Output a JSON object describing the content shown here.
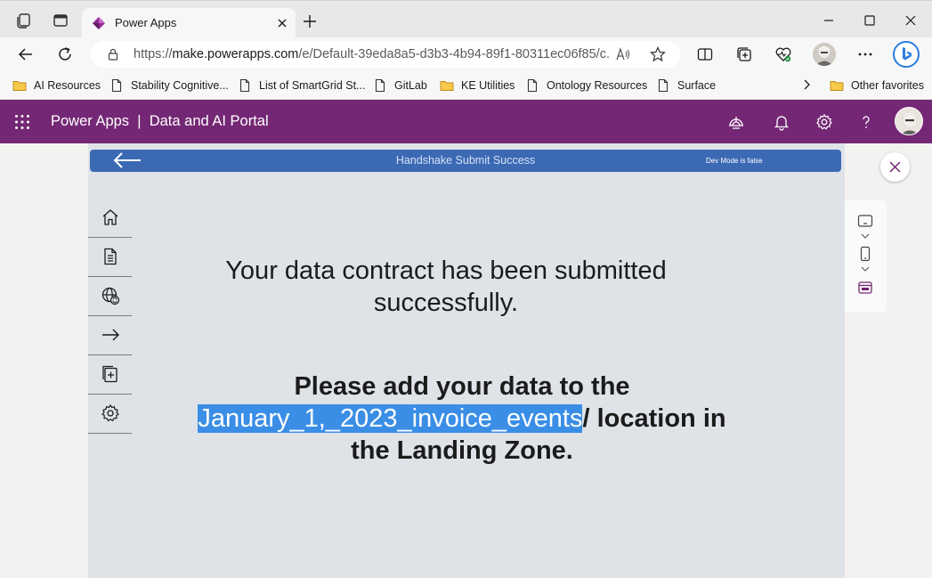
{
  "browser": {
    "tab_title": "Power Apps",
    "url_prefix": "https://",
    "url_host": "make.powerapps.com",
    "url_path": "/e/Default-39eda8a5-d3b3-4b94-89f1-80311ec06f85/c...",
    "favorites": [
      "AI Resources",
      "Stability Cognitive...",
      "List of SmartGrid St...",
      "GitLab",
      "KE Utilities",
      "Ontology Resources",
      "Surface"
    ],
    "other_favorites": "Other favorites"
  },
  "header": {
    "app_name": "Power Apps",
    "separator": "|",
    "environment": "Data and AI Portal"
  },
  "app": {
    "topbar_title": "Handshake Submit Success",
    "dev_mode": "Dev Mode is false",
    "message_1": "Your data contract has been submitted successfully.",
    "message_2_prefix": "Please add your data to the",
    "message_2_highlight": "January_1,_2023_invoice_events",
    "message_2_suffix": "/ location in the Landing Zone.",
    "sidenav": [
      "home-icon",
      "document-icon",
      "globe-sync-icon",
      "arrow-right-icon",
      "add-page-icon",
      "settings-icon"
    ]
  },
  "colors": {
    "header": "#742774",
    "topbar": "#3c69b4",
    "highlight": "#3a8ee6",
    "canvas": "#dfe3e8"
  }
}
